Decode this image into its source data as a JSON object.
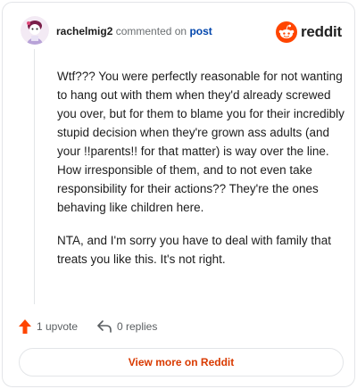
{
  "header": {
    "username": "rachelmig2",
    "action_text": "commented on",
    "post_link": "post",
    "brand": "reddit"
  },
  "comment": {
    "paragraphs": [
      "Wtf??? You were perfectly reasonable for not wanting to hang out with them when they'd already screwed you over, but for them to blame you for their incredibly stupid decision when they're grown ass adults (and your !!parents!! for that matter) is way over the line. How irresponsible of them, and to not even take responsibility for their actions?? They're the ones behaving like children here.",
      "NTA, and I'm sorry you have to deal with family that treats you like this. It's not right."
    ]
  },
  "actions": {
    "upvote_label": "1 upvote",
    "reply_label": "0 replies"
  },
  "footer": {
    "view_more_label": "View more on Reddit"
  },
  "colors": {
    "brand_orange": "#ff4500",
    "link_blue": "#0045ac",
    "view_more_text": "#d93a00",
    "border": "#e3e5e8"
  },
  "icons": {
    "avatar": "avatar-icon",
    "brand": "reddit-logo-icon",
    "upvote": "upvote-arrow-icon",
    "reply": "reply-arrow-icon"
  }
}
